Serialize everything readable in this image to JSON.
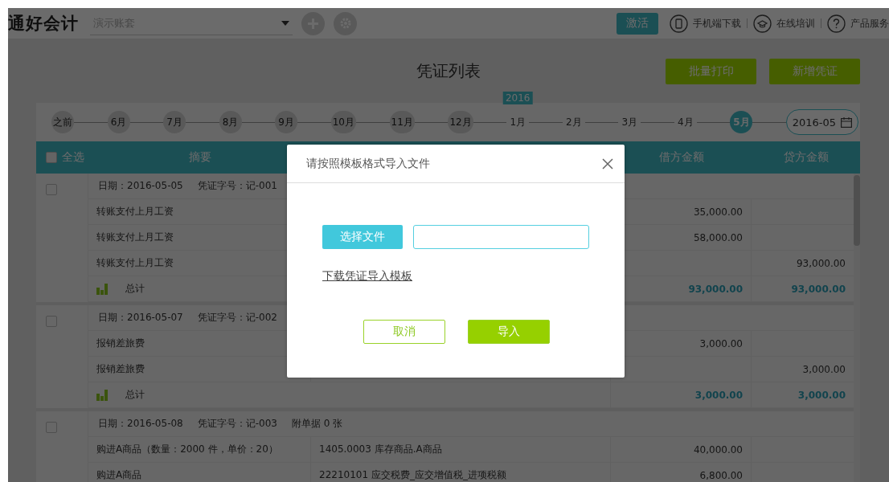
{
  "header": {
    "logo": "通好会计",
    "account_select": {
      "value": "演示账套"
    },
    "activate_button": "激活",
    "links": [
      {
        "kind": "phone",
        "label": "手机端下载"
      },
      {
        "kind": "training",
        "label": "在线培训"
      },
      {
        "kind": "help",
        "label": "产品服务"
      }
    ]
  },
  "page": {
    "title": "凭证列表",
    "actions": [
      "批量打印",
      "新增凭证"
    ]
  },
  "timeline": {
    "items": [
      {
        "label": "之前",
        "past": true,
        "selected": false
      },
      {
        "label": "6月",
        "past": true,
        "selected": false
      },
      {
        "label": "7月",
        "past": true,
        "selected": false
      },
      {
        "label": "8月",
        "past": true,
        "selected": false
      },
      {
        "label": "9月",
        "past": true,
        "selected": false
      },
      {
        "label": "10月",
        "past": true,
        "selected": false
      },
      {
        "label": "11月",
        "past": true,
        "selected": false
      },
      {
        "label": "12月",
        "past": true,
        "selected": false
      },
      {
        "label": "1月",
        "past": false,
        "selected": false,
        "badge": "2016"
      },
      {
        "label": "2月",
        "past": false,
        "selected": false
      },
      {
        "label": "3月",
        "past": false,
        "selected": false
      },
      {
        "label": "4月",
        "past": false,
        "selected": false
      },
      {
        "label": "5月",
        "past": false,
        "selected": true
      }
    ],
    "date_picker": "2016-05"
  },
  "table": {
    "select_all": {
      "label": "全选",
      "checked": false
    },
    "columns": [
      {
        "kind": "summary",
        "label": "摘要"
      },
      {
        "kind": "debit",
        "label": "借方金额"
      },
      {
        "kind": "credit",
        "label": "贷方金额"
      }
    ],
    "groups": [
      {
        "checked": false,
        "date": "日期：2016-05-05",
        "voucher_no": "凭证字号：记-001",
        "rows": [
          {
            "kind": "entry",
            "summary": "转账支付上月工资",
            "debit": "35,000.00"
          },
          {
            "kind": "entry",
            "summary": "转账支付上月工资",
            "debit": "58,000.00"
          },
          {
            "kind": "entry",
            "summary": "转账支付上月工资",
            "credit": "93,000.00"
          },
          {
            "kind": "total",
            "summary": "总计",
            "debit": "93,000.00",
            "credit": "93,000.00"
          }
        ]
      },
      {
        "checked": false,
        "date": "日期：2016-05-07",
        "voucher_no": "凭证字号：记-002",
        "rows": [
          {
            "kind": "entry",
            "summary": "报销差旅费",
            "debit": "3,000.00"
          },
          {
            "kind": "entry",
            "summary": "报销差旅费",
            "credit": "3,000.00"
          },
          {
            "kind": "total",
            "summary": "总计",
            "debit": "3,000.00",
            "credit": "3,000.00"
          }
        ]
      },
      {
        "checked": false,
        "date": "日期：2016-05-08",
        "voucher_no": "凭证字号：记-003",
        "attachments": "附单据 0 张",
        "rows": [
          {
            "kind": "entry",
            "summary": "购进A商品（数量：2000 件，单价：20）",
            "subject": "1405.0003  库存商品.A商品",
            "debit": "40,000.00"
          },
          {
            "kind": "entry",
            "summary": "购进A商品",
            "subject": "22210101 应交税费_应交增值税_进项税额",
            "debit": "6,800.00"
          }
        ]
      }
    ]
  },
  "dialog": {
    "title": "请按照模板格式导入文件",
    "choose_button": "选择文件",
    "download_link": "下载凭证导入模板",
    "buttons": [
      {
        "kind": "secondary",
        "label": "取消"
      },
      {
        "kind": "primary",
        "label": "导入"
      }
    ]
  }
}
